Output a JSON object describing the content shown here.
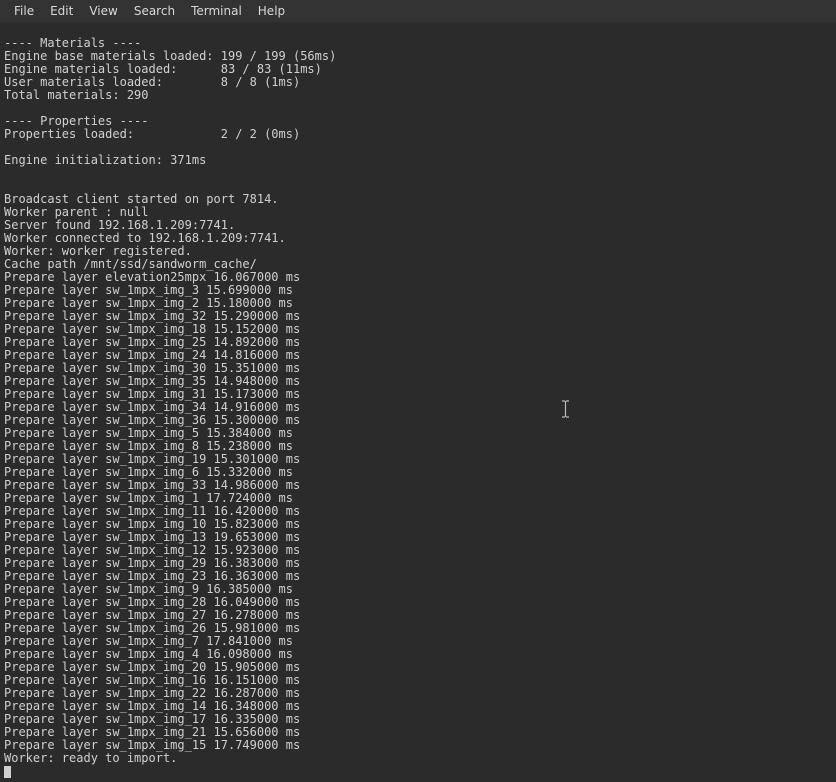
{
  "menubar": {
    "file": "File",
    "edit": "Edit",
    "view": "View",
    "search": "Search",
    "terminal": "Terminal",
    "help": "Help"
  },
  "terminal": {
    "materials_header": "---- Materials ----",
    "engine_base_materials": "Engine base materials loaded: 199 / 199 (56ms)",
    "engine_materials": "Engine materials loaded:      83 / 83 (11ms)",
    "user_materials": "User materials loaded:        8 / 8 (1ms)",
    "total_materials": "Total materials: 290",
    "properties_header": "---- Properties ----",
    "properties_loaded": "Properties loaded:            2 / 2 (0ms)",
    "engine_init": "Engine initialization: 371ms",
    "broadcast": "Broadcast client started on port 7814.",
    "worker_parent": "Worker parent : null",
    "server_found": "Server found 192.168.1.209:7741.",
    "worker_connected": "Worker connected to 192.168.1.209:7741.",
    "worker_registered": "Worker: worker registered.",
    "cache_path": "Cache path /mnt/ssd/sandworm_cache/",
    "layers": [
      "Prepare layer elevation25mpx 16.067000 ms",
      "Prepare layer sw_1mpx_img_3 15.699000 ms",
      "Prepare layer sw_1mpx_img_2 15.180000 ms",
      "Prepare layer sw_1mpx_img_32 15.290000 ms",
      "Prepare layer sw_1mpx_img_18 15.152000 ms",
      "Prepare layer sw_1mpx_img_25 14.892000 ms",
      "Prepare layer sw_1mpx_img_24 14.816000 ms",
      "Prepare layer sw_1mpx_img_30 15.351000 ms",
      "Prepare layer sw_1mpx_img_35 14.948000 ms",
      "Prepare layer sw_1mpx_img_31 15.173000 ms",
      "Prepare layer sw_1mpx_img_34 14.916000 ms",
      "Prepare layer sw_1mpx_img_36 15.300000 ms",
      "Prepare layer sw_1mpx_img_5 15.384000 ms",
      "Prepare layer sw_1mpx_img_8 15.238000 ms",
      "Prepare layer sw_1mpx_img_19 15.301000 ms",
      "Prepare layer sw_1mpx_img_6 15.332000 ms",
      "Prepare layer sw_1mpx_img_33 14.986000 ms",
      "Prepare layer sw_1mpx_img_1 17.724000 ms",
      "Prepare layer sw_1mpx_img_11 16.420000 ms",
      "Prepare layer sw_1mpx_img_10 15.823000 ms",
      "Prepare layer sw_1mpx_img_13 19.653000 ms",
      "Prepare layer sw_1mpx_img_12 15.923000 ms",
      "Prepare layer sw_1mpx_img_29 16.383000 ms",
      "Prepare layer sw_1mpx_img_23 16.363000 ms",
      "Prepare layer sw_1mpx_img_9 16.385000 ms",
      "Prepare layer sw_1mpx_img_28 16.049000 ms",
      "Prepare layer sw_1mpx_img_27 16.278000 ms",
      "Prepare layer sw_1mpx_img_26 15.981000 ms",
      "Prepare layer sw_1mpx_img_7 17.841000 ms",
      "Prepare layer sw_1mpx_img_4 16.098000 ms",
      "Prepare layer sw_1mpx_img_20 15.905000 ms",
      "Prepare layer sw_1mpx_img_16 16.151000 ms",
      "Prepare layer sw_1mpx_img_22 16.287000 ms",
      "Prepare layer sw_1mpx_img_14 16.348000 ms",
      "Prepare layer sw_1mpx_img_17 16.335000 ms",
      "Prepare layer sw_1mpx_img_21 15.656000 ms",
      "Prepare layer sw_1mpx_img_15 17.749000 ms"
    ],
    "worker_ready": "Worker: ready to import."
  }
}
